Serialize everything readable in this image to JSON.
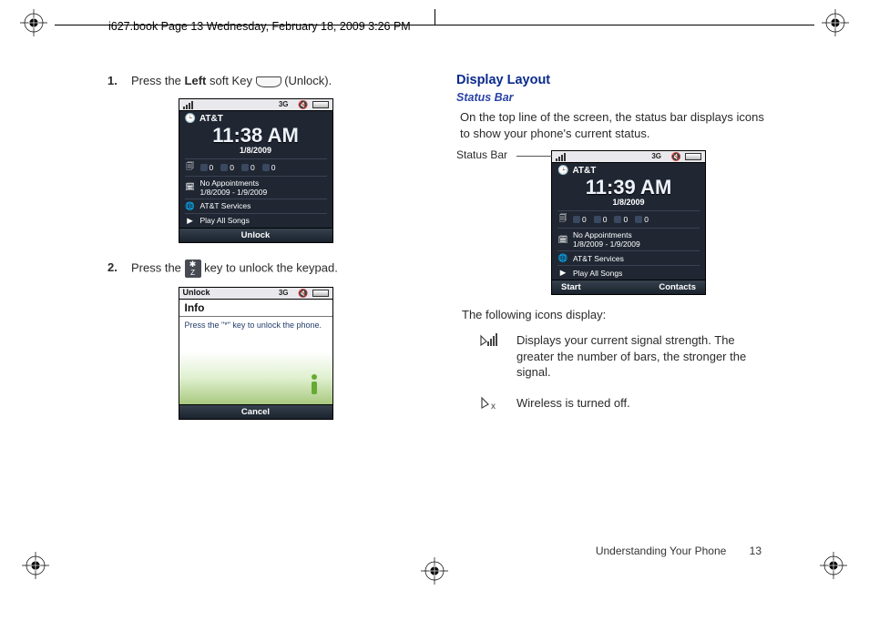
{
  "book_header": "i627.book  Page 13  Wednesday, February 18, 2009  3:26 PM",
  "left": {
    "step1_num": "1.",
    "step1_a": "Press the ",
    "step1_bold": "Left",
    "step1_b": " soft Key ",
    "step1_c": " (Unlock).",
    "step2_num": "2.",
    "step2_a": "Press the ",
    "step2_b": " key to unlock the keypad."
  },
  "shot1": {
    "threeg": "3G",
    "carrier": "AT&T",
    "time": "11:38 AM",
    "date": "1/8/2009",
    "counts": [
      "0",
      "0",
      "0",
      "0"
    ],
    "appts": "No Appointments",
    "range": "1/8/2009 - 1/9/2009",
    "svc": "AT&T Services",
    "songs": "Play All Songs",
    "soft_center": "Unlock"
  },
  "shot2": {
    "title": "Unlock",
    "info_h": "Info",
    "msg": "Press the \"*\" key to unlock the phone.",
    "threeg": "3G",
    "cancel": "Cancel"
  },
  "right": {
    "h1": "Display Layout",
    "h2": "Status Bar",
    "para": "On the top line of the screen, the status bar displays icons to show your phone's current status.",
    "callout_label": "Status Bar",
    "intro": "The following icons display:",
    "icon1_desc": "Displays your current signal strength. The greater the number of bars, the stronger the signal.",
    "icon2_desc": "Wireless is turned off."
  },
  "shot3": {
    "threeg": "3G",
    "carrier": "AT&T",
    "time": "11:39 AM",
    "date": "1/8/2009",
    "counts": [
      "0",
      "0",
      "0",
      "0"
    ],
    "appts": "No Appointments",
    "range": "1/8/2009 - 1/9/2009",
    "svc": "AT&T Services",
    "songs": "Play All Songs",
    "soft_left": "Start",
    "soft_right": "Contacts"
  },
  "footer": {
    "section": "Understanding Your Phone",
    "page": "13"
  }
}
